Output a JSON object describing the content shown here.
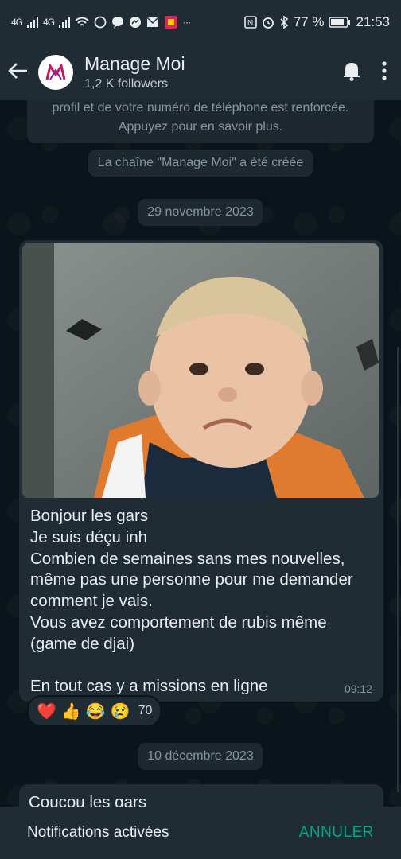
{
  "status_bar": {
    "signal1": "4G",
    "signal2": "4G",
    "extra": "···",
    "battery": "77 %",
    "time": "21:53"
  },
  "app_bar": {
    "title": "Manage Moi",
    "subtitle": "1,2 K followers"
  },
  "chat": {
    "security_notice": "profil et de votre numéro de téléphone est renforcée. Appuyez pour en savoir plus.",
    "channel_created": "La chaîne \"Manage Moi\" a été créée",
    "date_1": "29 novembre 2023",
    "message_1": {
      "text": "Bonjour les gars\nJe suis déçu inh\nCombien de semaines sans mes nouvelles, même pas une personne pour me demander comment je vais.\nVous avez comportement de rubis même (game de djai)\n\nEn tout cas y a missions en ligne",
      "time": "09:12",
      "reactions": [
        "❤️",
        "👍",
        "😂",
        "😢"
      ],
      "reaction_count": "70"
    },
    "date_2": "10 décembre 2023",
    "message_2": {
      "text": "Coucou les gars"
    }
  },
  "snackbar": {
    "text": "Notifications activées",
    "action": "ANNULER"
  },
  "colors": {
    "accent": "#00a884",
    "bubble": "#1f2c34",
    "background": "#0b141a"
  }
}
